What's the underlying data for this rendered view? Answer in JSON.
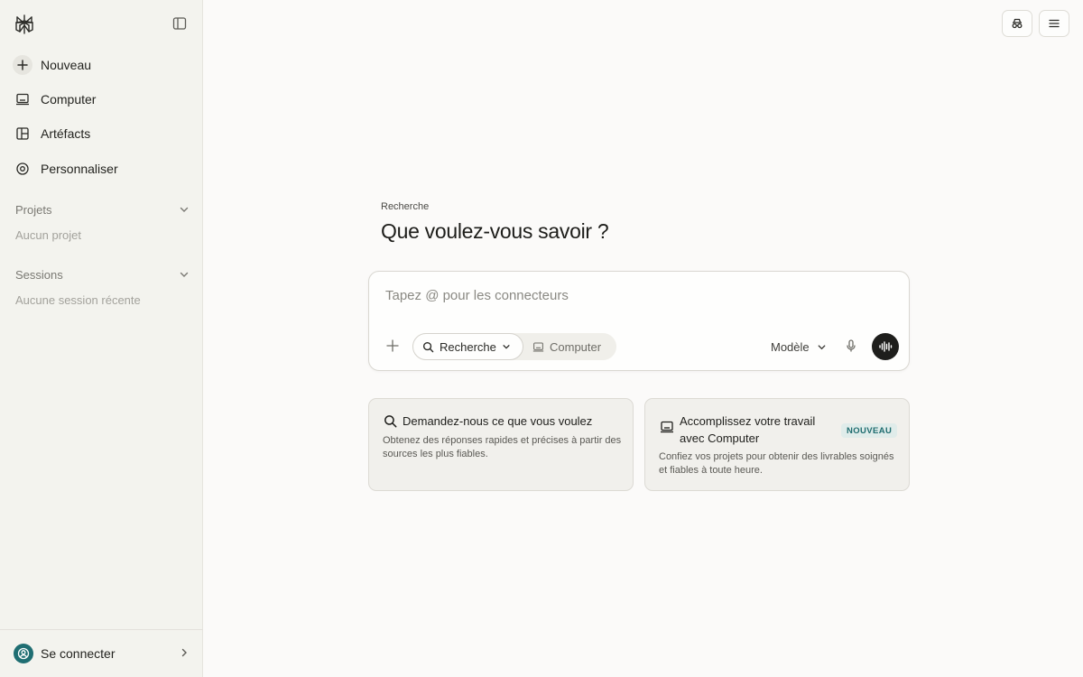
{
  "sidebar": {
    "nav": [
      {
        "label": "Nouveau",
        "icon": "plus-icon"
      },
      {
        "label": "Computer",
        "icon": "laptop-icon"
      },
      {
        "label": "Artéfacts",
        "icon": "layout-icon"
      },
      {
        "label": "Personnaliser",
        "icon": "target-icon"
      }
    ],
    "projects": {
      "title": "Projets",
      "empty": "Aucun projet"
    },
    "sessions": {
      "title": "Sessions",
      "empty": "Aucune session récente"
    },
    "signin_label": "Se connecter"
  },
  "main": {
    "eyebrow": "Recherche",
    "heading": "Que voulez-vous savoir ?",
    "composer": {
      "placeholder": "Tapez @ pour les connecteurs",
      "mode_search": "Recherche",
      "mode_computer": "Computer",
      "model_label": "Modèle"
    },
    "cards": [
      {
        "title": "Demandez-nous ce que vous voulez",
        "desc": "Obtenez des réponses rapides et précises à partir des sources les plus fiables.",
        "icon": "search-icon"
      },
      {
        "title": "Accomplissez votre travail avec Computer",
        "badge": "NOUVEAU",
        "desc": "Confiez vos projets pour obtenir des livrables soignés et fiables à toute heure.",
        "icon": "laptop-icon"
      }
    ]
  },
  "colors": {
    "sidebar_bg": "#f3f3ee",
    "page_bg": "#fbfaf9",
    "accent_teal": "#1f6e72",
    "voice_button": "#1e1e1c"
  }
}
